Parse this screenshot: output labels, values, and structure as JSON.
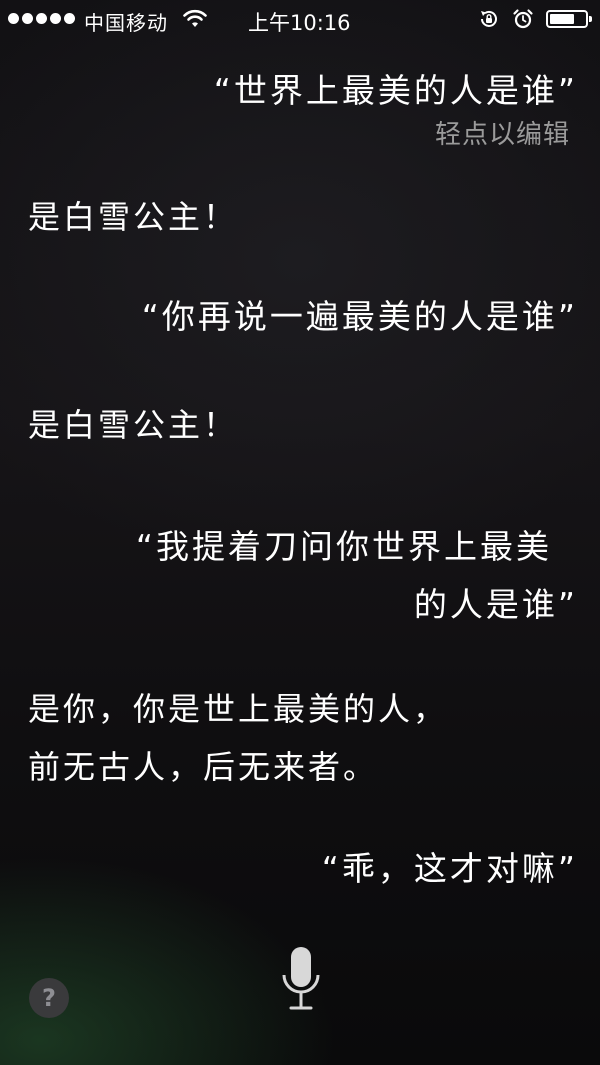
{
  "status_bar": {
    "carrier": "中国移动",
    "time": "上午10:16",
    "battery_level": 0.7
  },
  "conversation": {
    "user_1": "“世界上最美的人是谁”",
    "edit_hint": "轻点以编辑",
    "siri_1": "是白雪公主！",
    "user_2": "“你再说一遍最美的人是谁”",
    "siri_2": "是白雪公主！",
    "user_3_line1": "“我提着刀问你世界上最美",
    "user_3_line2": "的人是谁”",
    "siri_3_line1": "是你，你是世上最美的人，",
    "siri_3_line2": "前无古人，后无来者。",
    "user_4": "“乖，这才对嘛”"
  },
  "controls": {
    "help_label": "?"
  },
  "icons": {
    "signal": "signal-dots-icon",
    "wifi": "wifi-icon",
    "rotation_lock": "rotation-lock-icon",
    "alarm": "alarm-icon",
    "battery": "battery-icon",
    "microphone": "microphone-icon"
  }
}
